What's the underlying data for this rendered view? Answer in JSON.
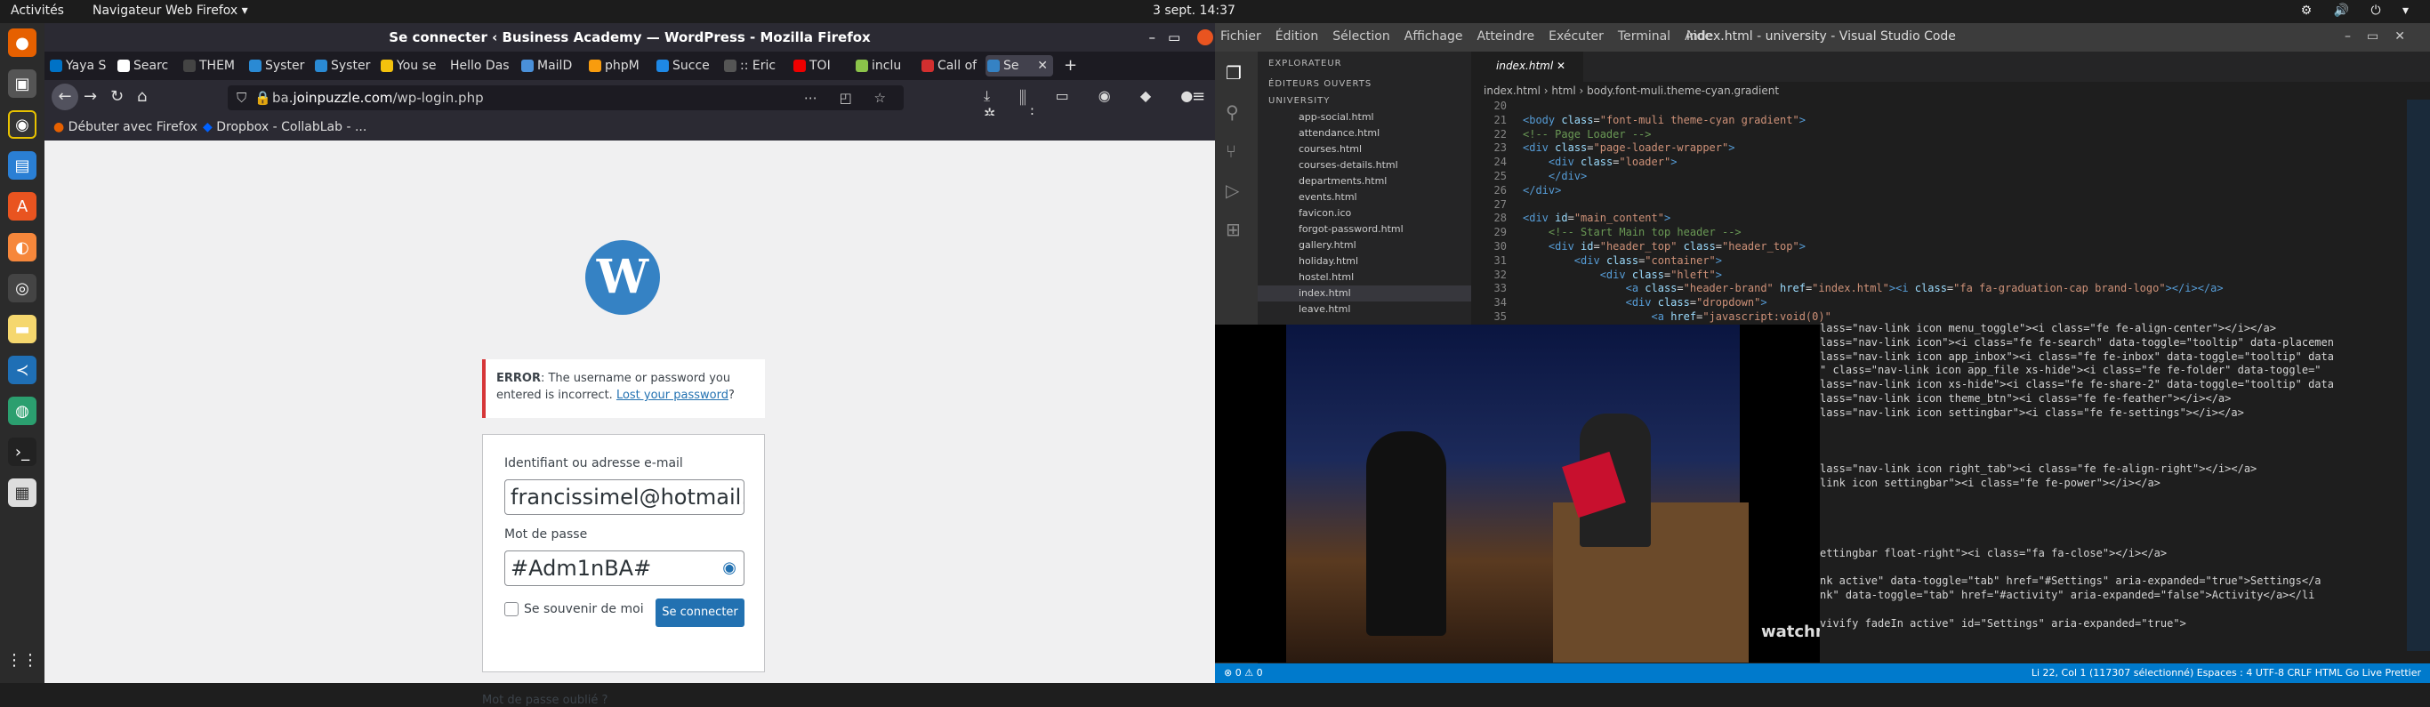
{
  "topbar": {
    "activities": "Activités",
    "app_menu": "Navigateur Web Firefox ▾",
    "clock": "3 sept.  14:37",
    "tray": "⚙ 🔊 ⏻ ▾"
  },
  "firefox": {
    "window_title": "Se connecter ‹ Business Academy — WordPress - Mozilla Firefox",
    "tabs": [
      "Yaya S",
      "Searc",
      "THEM",
      "Syster",
      "Syster",
      "You se",
      "Hello Das",
      "MailD",
      "phpM",
      "Succe",
      ":: Eric",
      "TOI",
      "inclu",
      "Call of",
      "Se"
    ],
    "url_prefix": "ba.",
    "url_host": "joinpuzzle.com",
    "url_path": "/wp-login.php",
    "bookmarks": [
      "Débuter avec Firefox",
      "Dropbox - CollabLab - ..."
    ],
    "page": {
      "logo": "W",
      "error_label": "ERROR",
      "error_text": ": The username or password you entered is incorrect. ",
      "error_link": "Lost your password",
      "error_tail": "?",
      "username_label": "Identifiant ou adresse e-mail",
      "username_value": "francissimel@hotmail.com",
      "password_label": "Mot de passe",
      "password_value": "#Adm1nBA#",
      "remember_label": "Se souvenir de moi",
      "submit_label": "Se connecter",
      "lost_password": "Mot de passe oublié ?"
    }
  },
  "vscode": {
    "title": "index.html - university - Visual Studio Code",
    "menu": [
      "Fichier",
      "Édition",
      "Sélection",
      "Affichage",
      "Atteindre",
      "Exécuter",
      "Terminal",
      "Aide"
    ],
    "explorer_title": "EXPLORATEUR",
    "open_editors": "ÉDITEURS OUVERTS",
    "folder": "UNIVERSITY",
    "files": [
      "app-social.html",
      "attendance.html",
      "courses.html",
      "courses-details.html",
      "departments.html",
      "events.html",
      "favicon.ico",
      "forgot-password.html",
      "gallery.html",
      "holiday.html",
      "hostel.html",
      "index.html",
      "leave.html"
    ],
    "tab": "index.html",
    "breadcrumb": "index.html › html › body.font-muli.theme-cyan.gradient",
    "status_left": "⊗ 0 ⚠ 0",
    "status_right": "Li 22, Col 1 (117307 sélectionné)   Espaces : 4   UTF-8   CRLF   HTML   Go Live   Prettier",
    "watermark": "watchmojo"
  }
}
